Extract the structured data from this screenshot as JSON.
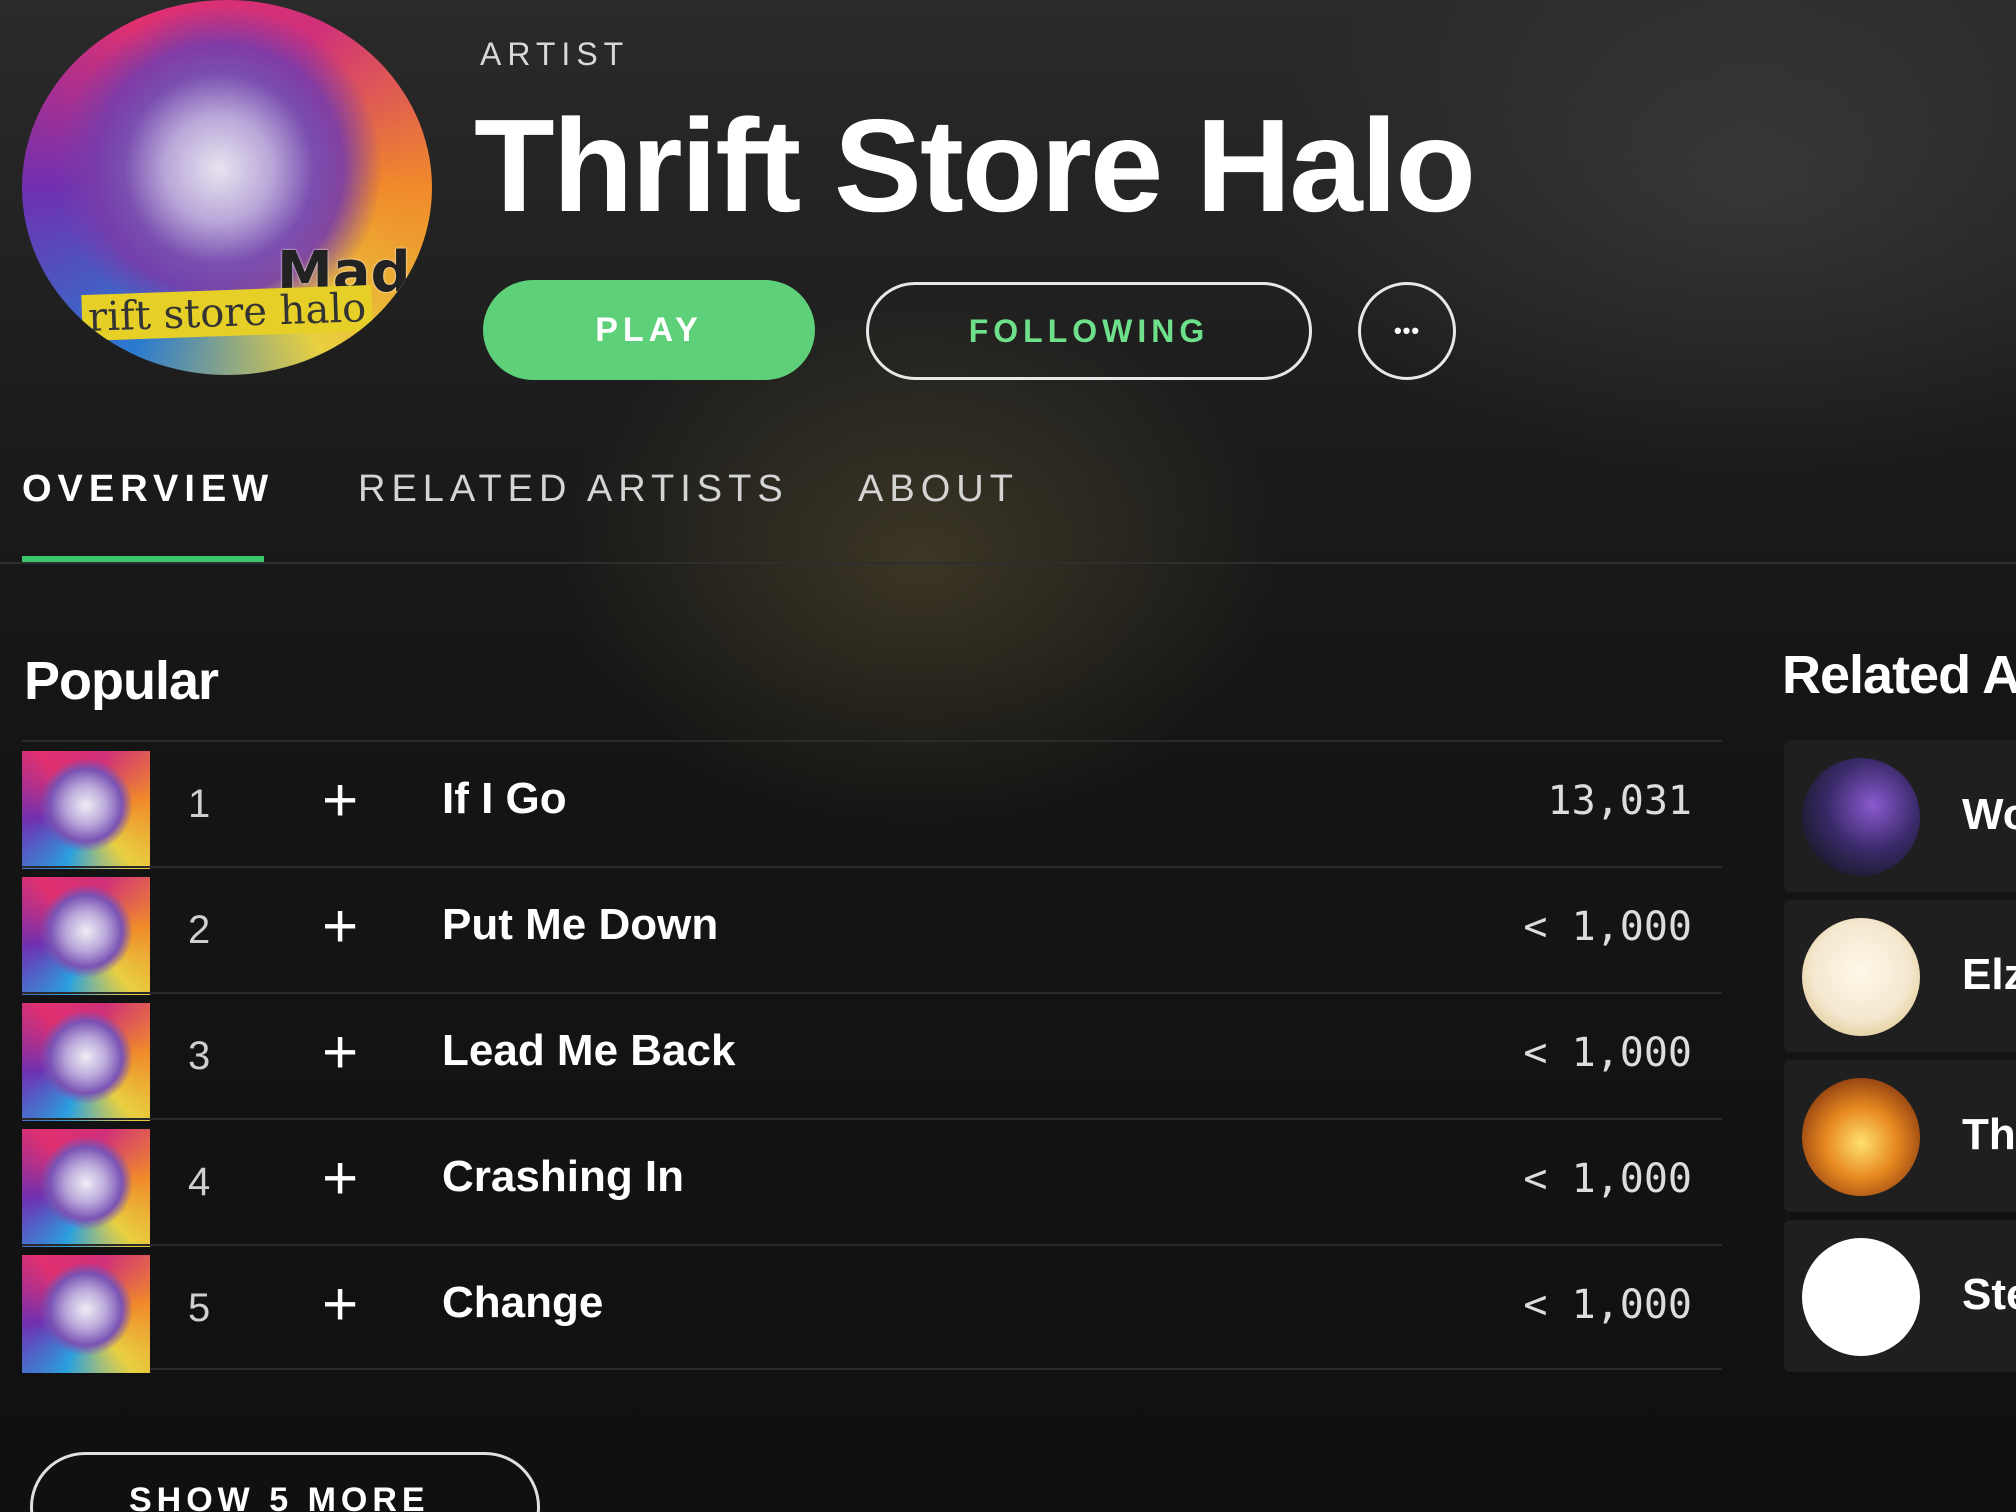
{
  "artist": {
    "type_label": "ARTIST",
    "name": "Thrift Store Halo",
    "avatar_text": "rift store halo",
    "avatar_mark": "Mad"
  },
  "actions": {
    "play_label": "PLAY",
    "following_label": "FOLLOWING",
    "more_label": "•••"
  },
  "tabs": [
    {
      "label": "OVERVIEW",
      "active": true
    },
    {
      "label": "RELATED ARTISTS",
      "active": false
    },
    {
      "label": "ABOUT",
      "active": false
    }
  ],
  "popular": {
    "title": "Popular",
    "tracks": [
      {
        "number": "1",
        "name": "If I Go",
        "plays": "13,031"
      },
      {
        "number": "2",
        "name": "Put Me Down",
        "plays": "< 1,000"
      },
      {
        "number": "3",
        "name": "Lead Me Back",
        "plays": "< 1,000"
      },
      {
        "number": "4",
        "name": "Crashing In",
        "plays": "< 1,000"
      },
      {
        "number": "5",
        "name": "Change",
        "plays": "< 1,000"
      }
    ],
    "add_icon": "+",
    "show_more_label": "SHOW 5 MORE"
  },
  "related": {
    "title": "Related A",
    "artists": [
      {
        "name": "Wo"
      },
      {
        "name": "Elz"
      },
      {
        "name": "The"
      },
      {
        "name": "Ste"
      }
    ]
  },
  "colors": {
    "accent": "#5fd07a",
    "following_text": "#6fe08a",
    "tab_underline": "#3cc46a",
    "background": "#131313"
  },
  "icons": {
    "add": "plus-icon",
    "more": "ellipsis-icon"
  }
}
